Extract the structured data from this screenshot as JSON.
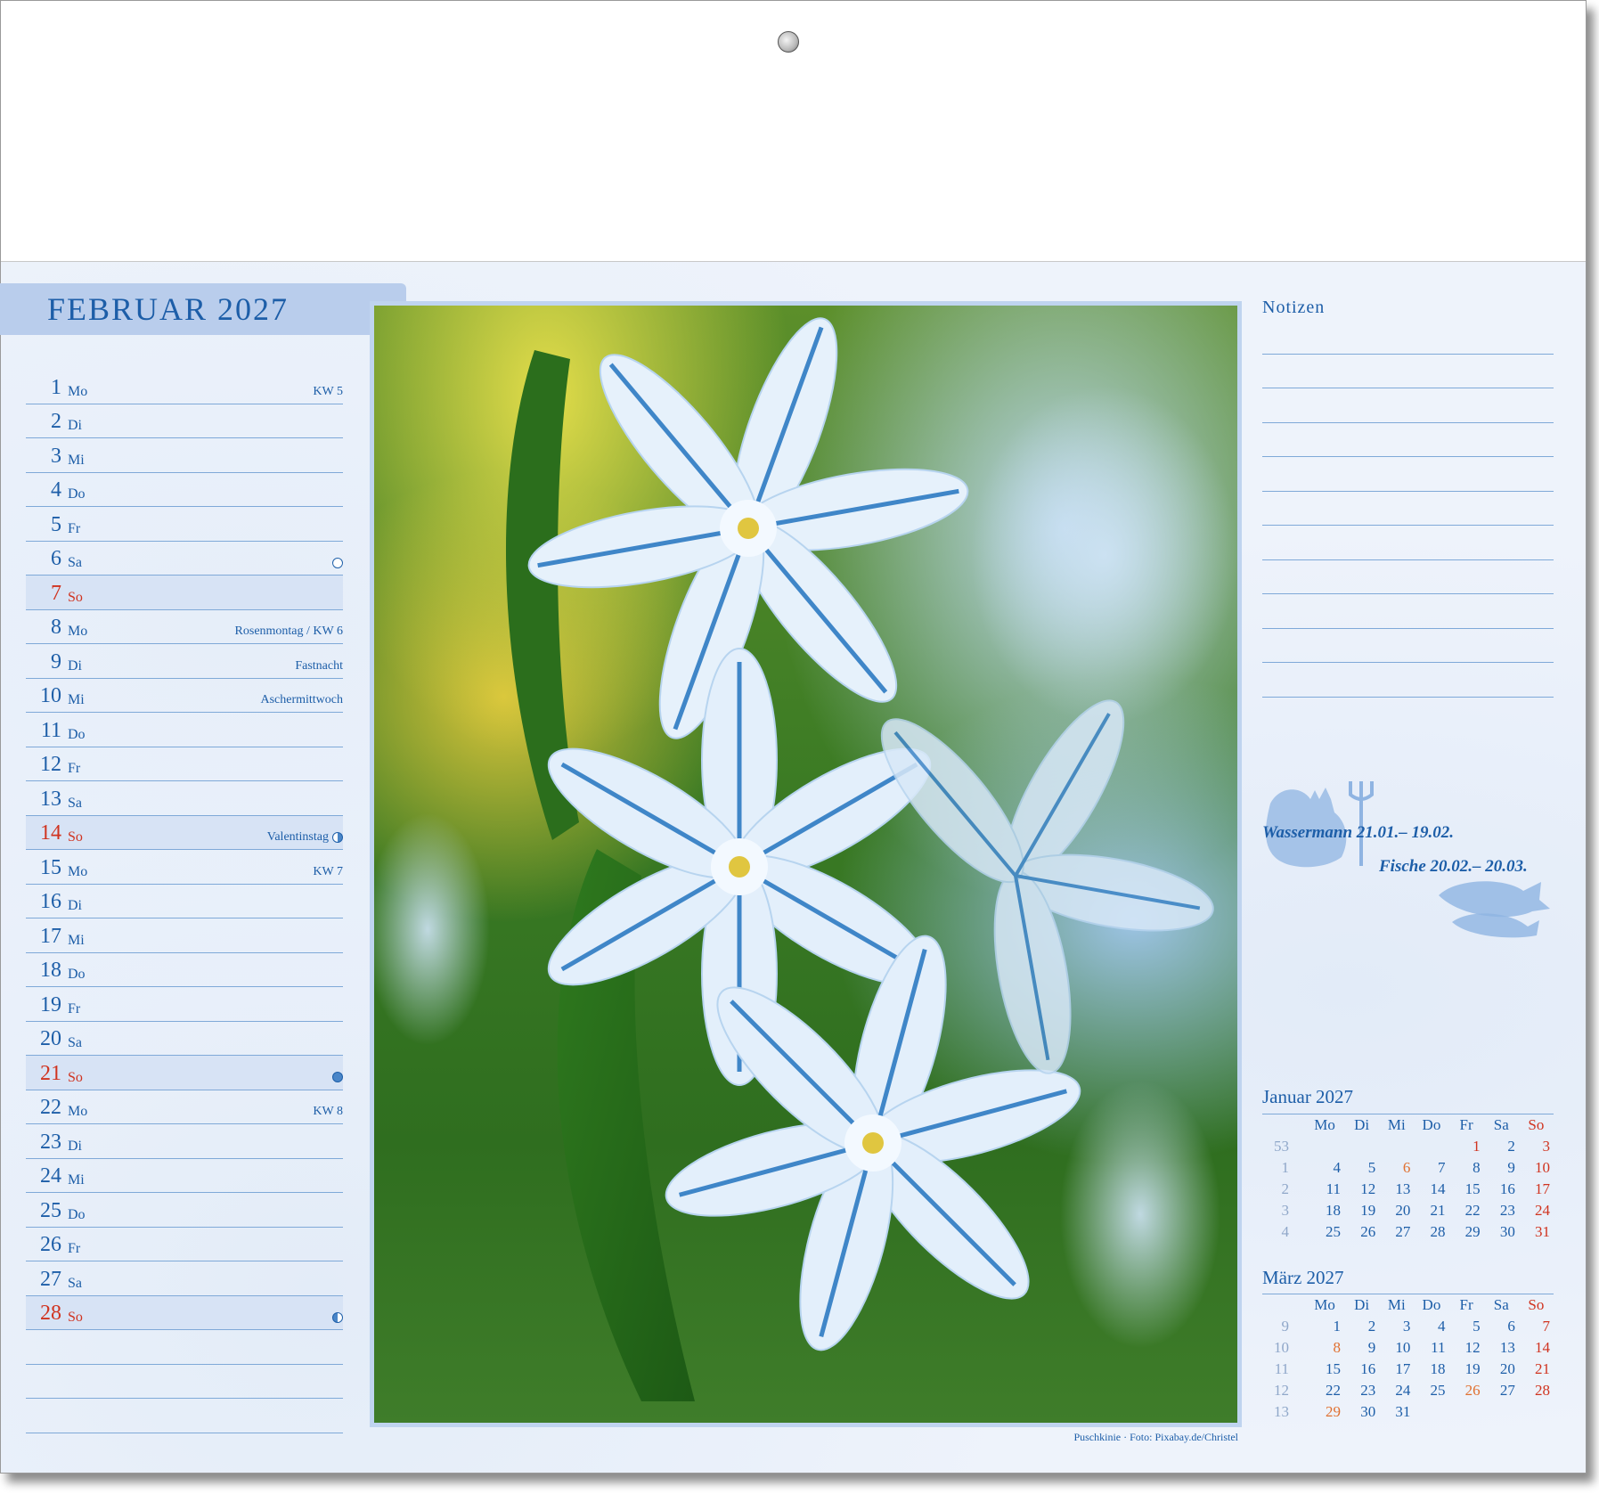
{
  "month_title": "FEBRUAR 2027",
  "days": [
    {
      "num": "1",
      "wd": "Mo",
      "note": "KW 5",
      "sun": false,
      "moon": ""
    },
    {
      "num": "2",
      "wd": "Di",
      "note": "",
      "sun": false,
      "moon": ""
    },
    {
      "num": "3",
      "wd": "Mi",
      "note": "",
      "sun": false,
      "moon": ""
    },
    {
      "num": "4",
      "wd": "Do",
      "note": "",
      "sun": false,
      "moon": ""
    },
    {
      "num": "5",
      "wd": "Fr",
      "note": "",
      "sun": false,
      "moon": ""
    },
    {
      "num": "6",
      "wd": "Sa",
      "note": "",
      "sun": false,
      "moon": "new"
    },
    {
      "num": "7",
      "wd": "So",
      "note": "",
      "sun": true,
      "moon": ""
    },
    {
      "num": "8",
      "wd": "Mo",
      "note": "Rosenmontag / KW 6",
      "sun": false,
      "moon": ""
    },
    {
      "num": "9",
      "wd": "Di",
      "note": "Fastnacht",
      "sun": false,
      "moon": ""
    },
    {
      "num": "10",
      "wd": "Mi",
      "note": "Aschermittwoch",
      "sun": false,
      "moon": ""
    },
    {
      "num": "11",
      "wd": "Do",
      "note": "",
      "sun": false,
      "moon": ""
    },
    {
      "num": "12",
      "wd": "Fr",
      "note": "",
      "sun": false,
      "moon": ""
    },
    {
      "num": "13",
      "wd": "Sa",
      "note": "",
      "sun": false,
      "moon": ""
    },
    {
      "num": "14",
      "wd": "So",
      "note": "Valentinstag",
      "sun": true,
      "moon": "first"
    },
    {
      "num": "15",
      "wd": "Mo",
      "note": "KW 7",
      "sun": false,
      "moon": ""
    },
    {
      "num": "16",
      "wd": "Di",
      "note": "",
      "sun": false,
      "moon": ""
    },
    {
      "num": "17",
      "wd": "Mi",
      "note": "",
      "sun": false,
      "moon": ""
    },
    {
      "num": "18",
      "wd": "Do",
      "note": "",
      "sun": false,
      "moon": ""
    },
    {
      "num": "19",
      "wd": "Fr",
      "note": "",
      "sun": false,
      "moon": ""
    },
    {
      "num": "20",
      "wd": "Sa",
      "note": "",
      "sun": false,
      "moon": ""
    },
    {
      "num": "21",
      "wd": "So",
      "note": "",
      "sun": true,
      "moon": "full"
    },
    {
      "num": "22",
      "wd": "Mo",
      "note": "KW 8",
      "sun": false,
      "moon": ""
    },
    {
      "num": "23",
      "wd": "Di",
      "note": "",
      "sun": false,
      "moon": ""
    },
    {
      "num": "24",
      "wd": "Mi",
      "note": "",
      "sun": false,
      "moon": ""
    },
    {
      "num": "25",
      "wd": "Do",
      "note": "",
      "sun": false,
      "moon": ""
    },
    {
      "num": "26",
      "wd": "Fr",
      "note": "",
      "sun": false,
      "moon": ""
    },
    {
      "num": "27",
      "wd": "Sa",
      "note": "",
      "sun": false,
      "moon": ""
    },
    {
      "num": "28",
      "wd": "So",
      "note": "",
      "sun": true,
      "moon": "last"
    }
  ],
  "photo_caption": "Puschkinie · Foto: Pixabay.de/Christel",
  "notes_title": "Notizen",
  "zodiac": {
    "aquarius": "Wassermann 21.01.– 19.02.",
    "pisces": "Fische 20.02.– 20.03."
  },
  "mini_calendars": [
    {
      "title": "Januar 2027",
      "header": [
        "Mo",
        "Di",
        "Mi",
        "Do",
        "Fr",
        "Sa",
        "So"
      ],
      "weeks": [
        {
          "wk": "53",
          "days": [
            "",
            "",
            "",
            "",
            "1",
            "2",
            "3"
          ]
        },
        {
          "wk": "1",
          "days": [
            "4",
            "5",
            "6",
            "7",
            "8",
            "9",
            "10"
          ]
        },
        {
          "wk": "2",
          "days": [
            "11",
            "12",
            "13",
            "14",
            "15",
            "16",
            "17"
          ]
        },
        {
          "wk": "3",
          "days": [
            "18",
            "19",
            "20",
            "21",
            "22",
            "23",
            "24"
          ]
        },
        {
          "wk": "4",
          "days": [
            "25",
            "26",
            "27",
            "28",
            "29",
            "30",
            "31"
          ]
        }
      ],
      "holiday_cells": [
        [
          0,
          4
        ],
        [
          1,
          2
        ]
      ]
    },
    {
      "title": "März 2027",
      "header": [
        "Mo",
        "Di",
        "Mi",
        "Do",
        "Fr",
        "Sa",
        "So"
      ],
      "weeks": [
        {
          "wk": "9",
          "days": [
            "1",
            "2",
            "3",
            "4",
            "5",
            "6",
            "7"
          ]
        },
        {
          "wk": "10",
          "days": [
            "8",
            "9",
            "10",
            "11",
            "12",
            "13",
            "14"
          ]
        },
        {
          "wk": "11",
          "days": [
            "15",
            "16",
            "17",
            "18",
            "19",
            "20",
            "21"
          ]
        },
        {
          "wk": "12",
          "days": [
            "22",
            "23",
            "24",
            "25",
            "26",
            "27",
            "28"
          ]
        },
        {
          "wk": "13",
          "days": [
            "29",
            "30",
            "31",
            "",
            "",
            "",
            ""
          ]
        }
      ],
      "holiday_cells": [
        [
          1,
          0
        ],
        [
          3,
          4
        ],
        [
          4,
          0
        ]
      ]
    }
  ],
  "colors": {
    "primary": "#1d5ea8",
    "sunday": "#d0331f",
    "holiday": "#e07030",
    "line": "#7fa9d8"
  }
}
